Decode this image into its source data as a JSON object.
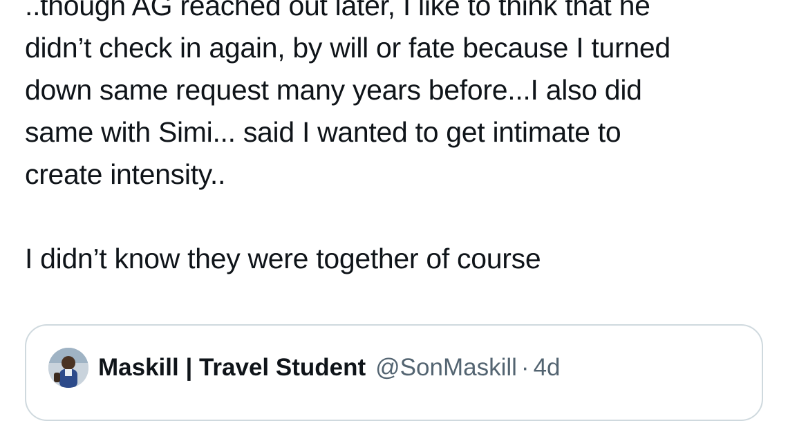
{
  "tweet": {
    "lines": [
      "..though AG reached out later, I like to think that he",
      "didn’t check in again, by will or fate because I turned",
      "down same request many years before...I also did",
      "same with Simi... said I wanted to get intimate to",
      "create intensity..",
      "I didn’t know they were together of course"
    ]
  },
  "quote": {
    "author_name": "Maskill | Travel Student",
    "handle": "@SonMaskill",
    "separator": "·",
    "age": "4d",
    "avatar_icon": "user-avatar-photo"
  },
  "colors": {
    "text_primary": "#0f1419",
    "text_secondary": "#536471",
    "card_border": "#cfd9de"
  }
}
